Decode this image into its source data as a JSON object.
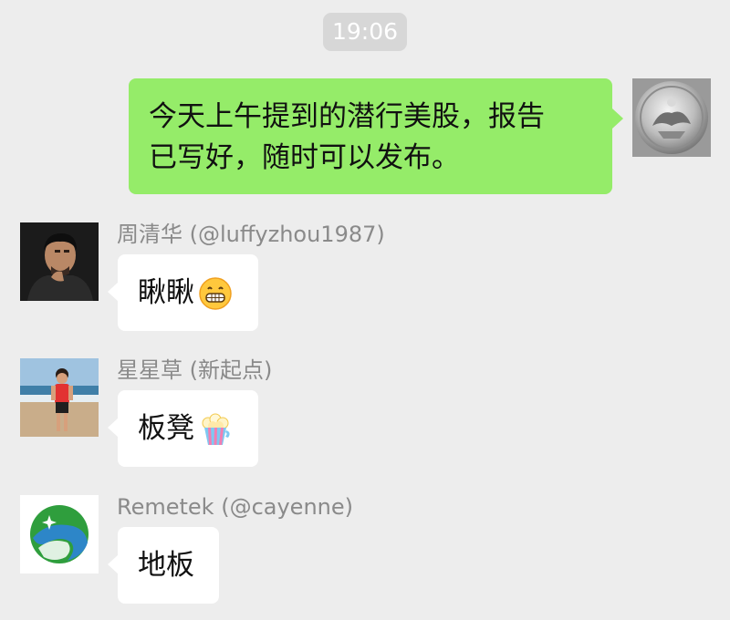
{
  "chat": {
    "time": "19:06",
    "messages": [
      {
        "sender": "me",
        "avatar_icon": "silver-coin-avatar",
        "lines": [
          "今天上午提到的潜行美股，报告",
          "已写好，随时可以发布。"
        ]
      },
      {
        "sender_name": "周清华 (@luffyzhou1987)",
        "avatar_icon": "man-portrait-avatar",
        "text": "瞅瞅",
        "emoji": "grinning-face-emoji"
      },
      {
        "sender_name": "星星草 (新起点)",
        "avatar_icon": "boy-on-beach-avatar",
        "text": "板凳",
        "emoji": "popcorn-emoji"
      },
      {
        "sender_name": "Remetek (@cayenne)",
        "avatar_icon": "remetek-logo-avatar",
        "text": "地板"
      }
    ]
  },
  "colors": {
    "background": "#ededed",
    "own_bubble": "#95ec69",
    "other_bubble": "#ffffff",
    "name_text": "#8a8a8a",
    "time_pill": "#d7d7d7"
  }
}
